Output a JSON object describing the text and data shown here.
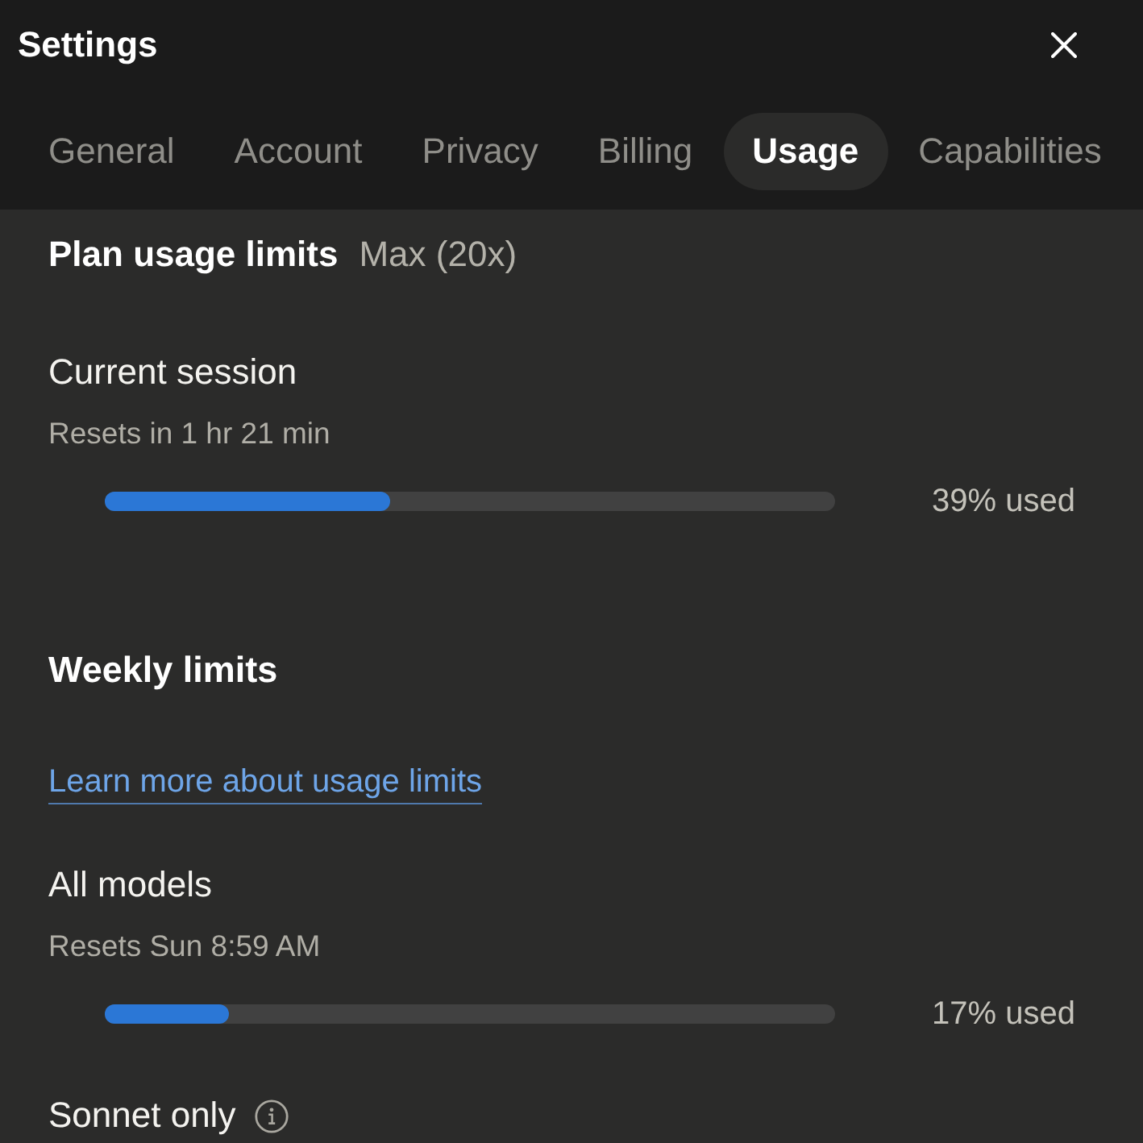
{
  "window": {
    "title": "Settings"
  },
  "tabs": [
    {
      "label": "General",
      "selected": false
    },
    {
      "label": "Account",
      "selected": false
    },
    {
      "label": "Privacy",
      "selected": false
    },
    {
      "label": "Billing",
      "selected": false
    },
    {
      "label": "Usage",
      "selected": true
    },
    {
      "label": "Capabilities",
      "selected": false
    }
  ],
  "plan": {
    "title": "Plan usage limits",
    "tier": "Max (20x)"
  },
  "session": {
    "name": "Current session",
    "reset": "Resets in 1 hr 21 min",
    "level": 0.39,
    "reading": "39% used"
  },
  "weekly": {
    "title": "Weekly limits",
    "link": "Learn more about usage limits",
    "limits": [
      {
        "name": "All models",
        "info": false,
        "reset": "Resets Sun 8:59 AM",
        "level": 0.17,
        "reading": "17% used"
      },
      {
        "name": "Sonnet only",
        "info": true
      }
    ]
  }
}
